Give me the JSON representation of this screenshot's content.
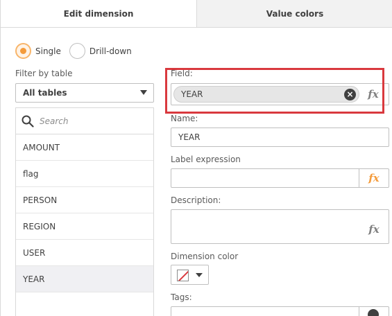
{
  "tabs": [
    {
      "label": "Edit dimension",
      "active": true
    },
    {
      "label": "Value colors",
      "active": false
    }
  ],
  "mode": {
    "options": [
      {
        "label": "Single",
        "checked": true
      },
      {
        "label": "Drill-down",
        "checked": false
      }
    ]
  },
  "filter": {
    "label": "Filter by table",
    "selected": "All tables"
  },
  "search": {
    "placeholder": "Search"
  },
  "fields_list": {
    "items": [
      {
        "label": "AMOUNT",
        "selected": false
      },
      {
        "label": "flag",
        "selected": false
      },
      {
        "label": "PERSON",
        "selected": false
      },
      {
        "label": "REGION",
        "selected": false
      },
      {
        "label": "USER",
        "selected": false
      },
      {
        "label": "YEAR",
        "selected": true
      }
    ]
  },
  "form": {
    "field_label": "Field:",
    "field_value": "YEAR",
    "name_label": "Name:",
    "name_value": "YEAR",
    "label_expression_label": "Label expression",
    "label_expression_value": "",
    "description_label": "Description:",
    "description_value": "",
    "dimension_color_label": "Dimension color",
    "tags_label": "Tags:",
    "fx_symbol": "fx"
  },
  "colors": {
    "accent": "#f49b3b",
    "highlight": "#d9393e"
  }
}
